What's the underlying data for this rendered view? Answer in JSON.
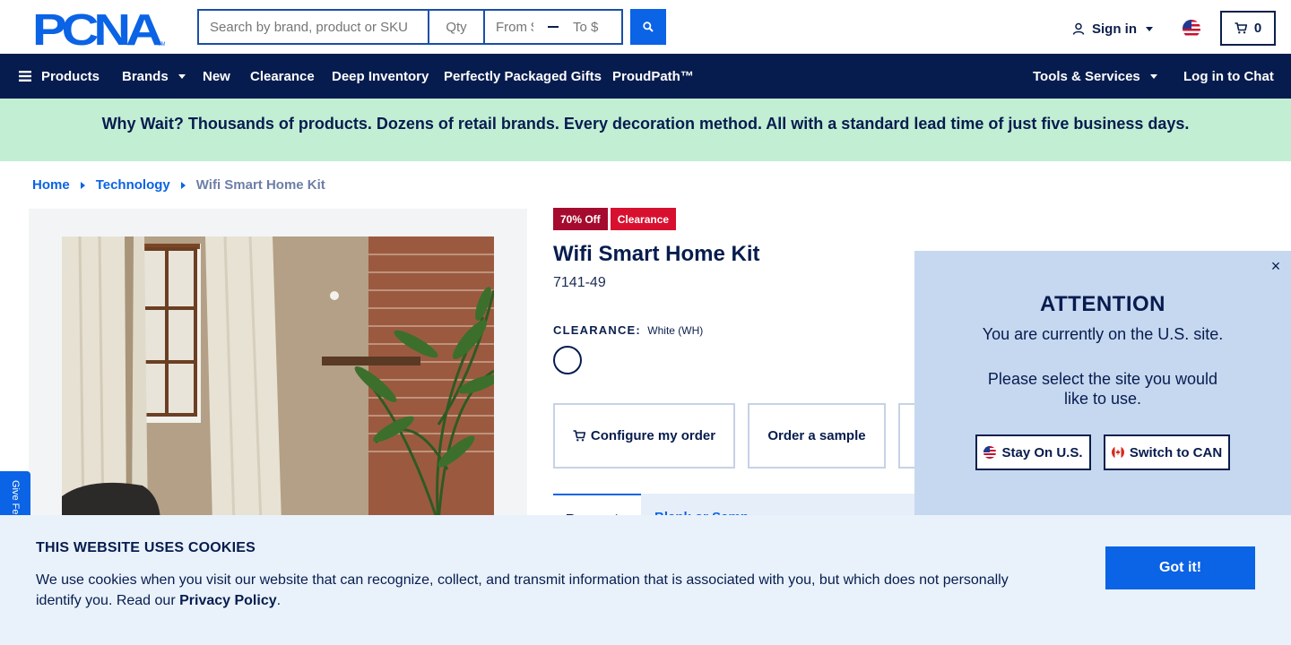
{
  "header": {
    "logo_text": "PCNA",
    "search_placeholder": "Search by brand, product or SKU",
    "qty_placeholder": "Qty",
    "price_from_placeholder": "From $",
    "price_to_placeholder": "To $",
    "search_icon": "search-icon",
    "sign_in_label": "Sign in",
    "cart_count": "0",
    "brand_color": "#0b63e5",
    "navy": "#071c4e"
  },
  "nav": {
    "products": "Products",
    "brands": "Brands",
    "new": "New",
    "clearance": "Clearance",
    "deep_inventory": "Deep Inventory",
    "gifts": "Perfectly Packaged Gifts",
    "proudpath": "ProudPath™",
    "tools": "Tools & Services",
    "chat": "Log in to Chat"
  },
  "promo": {
    "text": "Why Wait? Thousands of products. Dozens of retail brands. Every decoration method. All with a standard lead time of just five business days."
  },
  "breadcrumb": {
    "home": "Home",
    "category": "Technology",
    "current": "Wifi Smart Home Kit"
  },
  "feedback": {
    "label": "Give Feedback"
  },
  "product": {
    "badge_off": "70% Off",
    "badge_clearance": "Clearance",
    "title": "Wifi Smart Home Kit",
    "sku": "7141-49",
    "color_label": "CLEARANCE:",
    "color_value": "White (WH)",
    "configure_label": "Configure my order",
    "sample_label": "Order a sample",
    "tab_1": "Request",
    "tab_2": "Blank or Samp"
  },
  "attention": {
    "close_label": "×",
    "heading": "ATTENTION",
    "line1": "You are currently on the U.S. site.",
    "line2": "Please select the site you would like to use.",
    "stay_label": "Stay On U.S.",
    "switch_label": "Switch to CAN"
  },
  "cookie": {
    "heading": "THIS WEBSITE USES COOKIES",
    "text": "We use cookies when you visit our website that can recognize, collect, and transmit information that is associated with you, but which does not personally identify you. Read our ",
    "policy_link": "Privacy Policy",
    "period": ".",
    "button": "Got it!"
  }
}
